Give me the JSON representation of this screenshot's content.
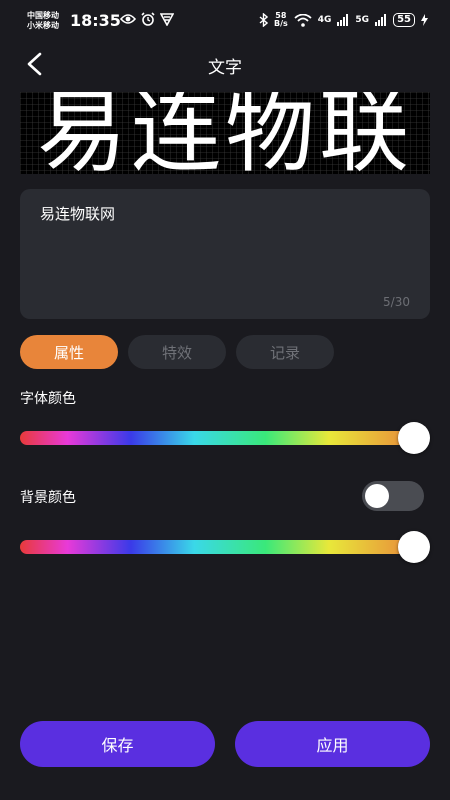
{
  "status": {
    "carrier1": "中国移动",
    "carrier2": "小米移动",
    "time": "18:35",
    "net_speed_top": "58",
    "net_speed_bottom": "B/s",
    "sig1": "4G",
    "sig2": "5G",
    "battery": "55"
  },
  "nav": {
    "title": "文字"
  },
  "led": {
    "text": "易连物联"
  },
  "input": {
    "value": "易连物联网",
    "counter": "5/30"
  },
  "tabs": [
    {
      "label": "属性",
      "active": true
    },
    {
      "label": "特效",
      "active": false
    },
    {
      "label": "记录",
      "active": false
    }
  ],
  "font_color": {
    "label": "字体颜色",
    "value": 1.0
  },
  "bg_color": {
    "label": "背景颜色",
    "enabled": false,
    "value": 1.0
  },
  "buttons": {
    "save": "保存",
    "apply": "应用"
  },
  "colors": {
    "accent_orange": "#e8853a",
    "button_purple": "#5a2fe0",
    "background": "#1a1a1f"
  }
}
